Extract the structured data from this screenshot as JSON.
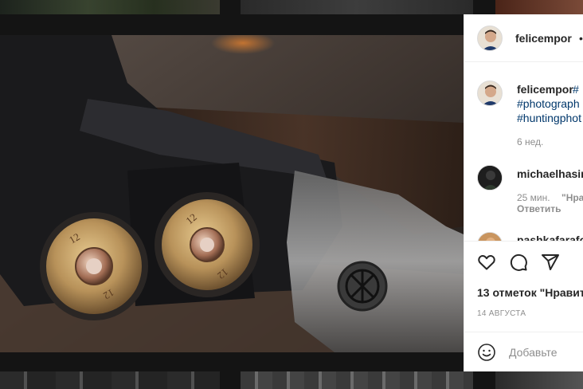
{
  "post": {
    "author": "felicempor",
    "header_separator": "•",
    "avatar_icon": "user-avatar",
    "caption_tags": [
      "#",
      "#photograph",
      "#huntingphot"
    ],
    "posted_ago": "6 нед."
  },
  "comments": [
    {
      "user": "michaelhasin",
      "time": "25 мин.",
      "reply_preview": "\"Нра",
      "reply_label": "Ответить"
    },
    {
      "user": "pashkafarafo"
    }
  ],
  "actions": {
    "like_icon": "heart-icon",
    "comment_icon": "comment-icon",
    "share_icon": "send-icon",
    "likes_text": "13 отметок \"Нравит",
    "date": "14 АВГУСТА"
  },
  "add_comment": {
    "emoji_icon": "emoji-icon",
    "placeholder": "Добавьте"
  },
  "colors": {
    "link": "#00376b",
    "muted": "#8e8e8e",
    "text": "#262626",
    "backdrop": "#141414"
  }
}
